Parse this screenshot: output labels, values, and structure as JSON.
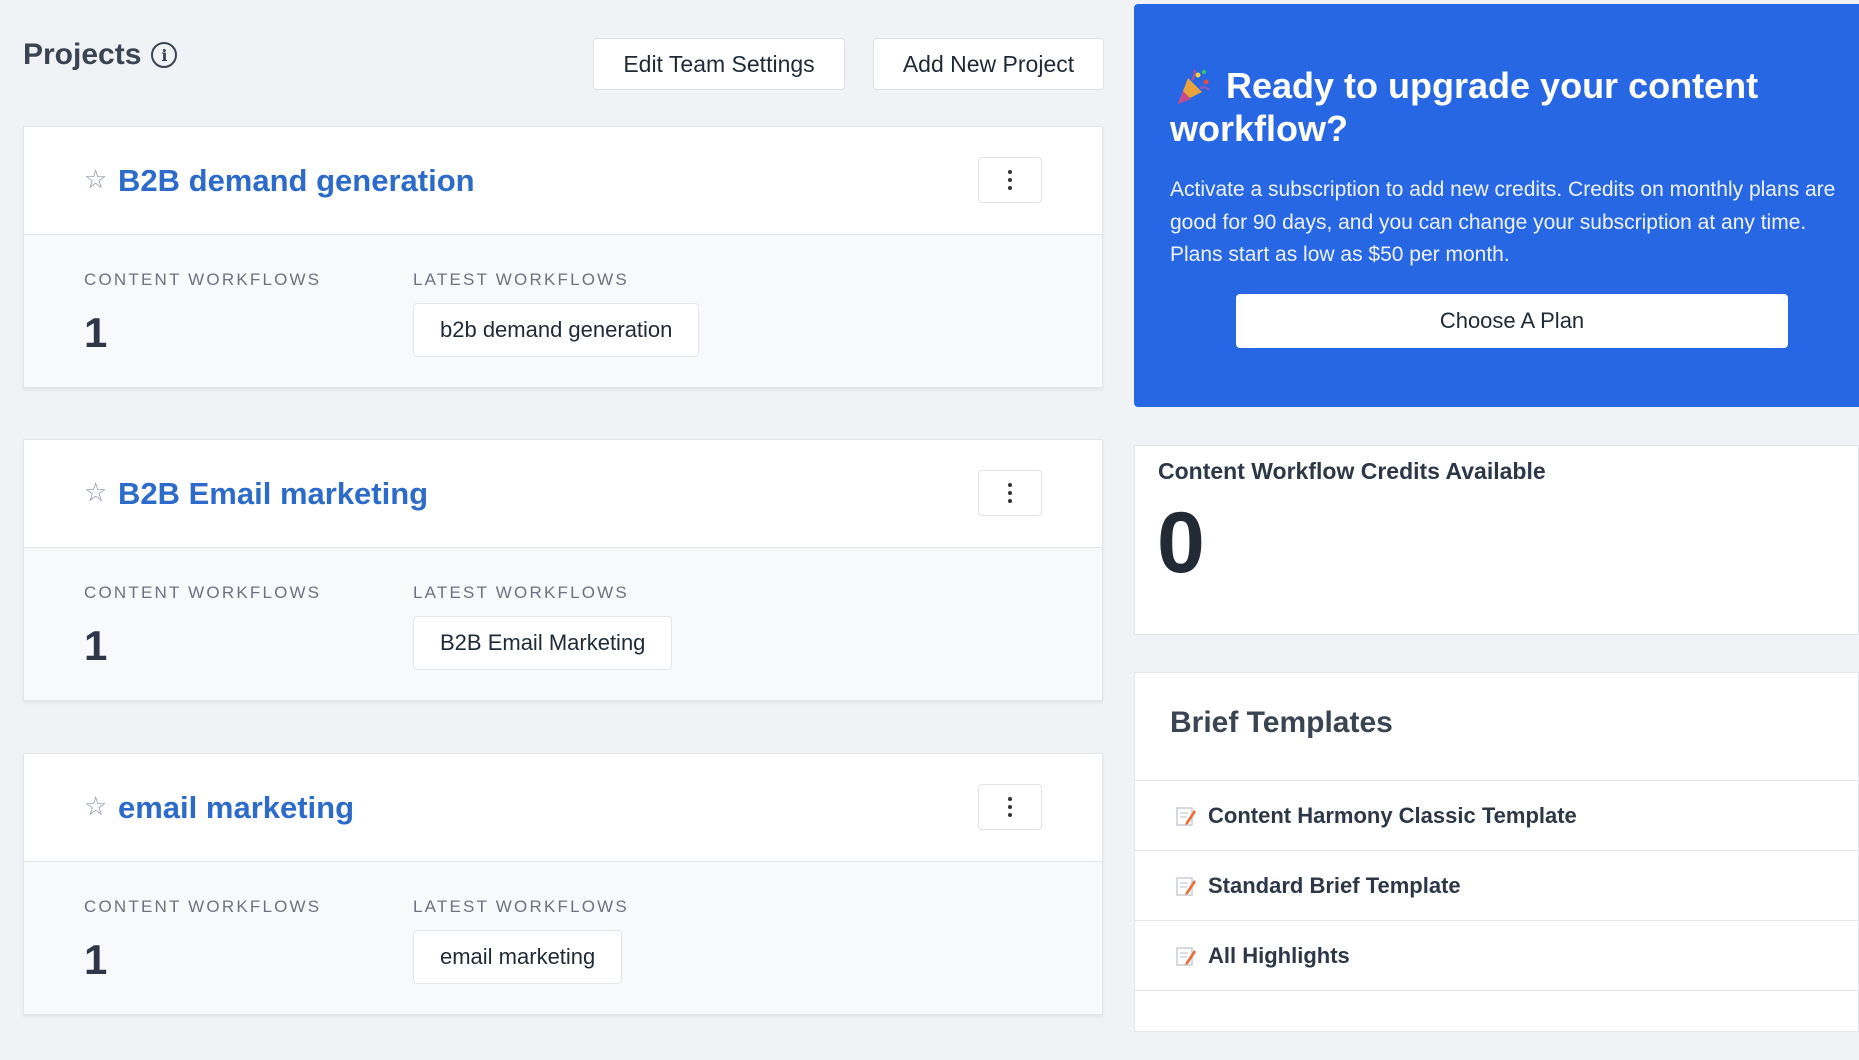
{
  "header": {
    "title": "Projects",
    "edit_team_settings": "Edit Team Settings",
    "add_new_project": "Add New Project"
  },
  "projects": [
    {
      "name": "B2B demand generation",
      "content_workflows_label": "CONTENT WORKFLOWS",
      "latest_workflows_label": "LATEST WORKFLOWS",
      "count": "1",
      "latest_workflow": "b2b demand generation"
    },
    {
      "name": "B2B Email marketing",
      "content_workflows_label": "CONTENT WORKFLOWS",
      "latest_workflows_label": "LATEST WORKFLOWS",
      "count": "1",
      "latest_workflow": "B2B Email Marketing"
    },
    {
      "name": "email marketing",
      "content_workflows_label": "CONTENT WORKFLOWS",
      "latest_workflows_label": "LATEST WORKFLOWS",
      "count": "1",
      "latest_workflow": "email marketing"
    }
  ],
  "upgrade": {
    "title": "Ready to upgrade your content workflow?",
    "text": "Activate a subscription to add new credits. Credits on monthly plans are good for 90 days, and you can change your subscription at any time. Plans start as low as $50 per month.",
    "button": "Choose A Plan",
    "color": "#2867e3"
  },
  "credits": {
    "label": "Content Workflow Credits Available",
    "value": "0"
  },
  "brief_templates": {
    "title": "Brief Templates",
    "items": [
      "Content Harmony Classic Template",
      "Standard Brief Template",
      "All Highlights"
    ]
  },
  "icons": {
    "info": "info-icon",
    "star": "star-outline-icon",
    "kebab": "kebab-menu-icon",
    "party": "party-popper-icon",
    "memo": "memo-icon"
  },
  "colors": {
    "link": "#2c6bc9",
    "background": "#f0f2f5"
  }
}
